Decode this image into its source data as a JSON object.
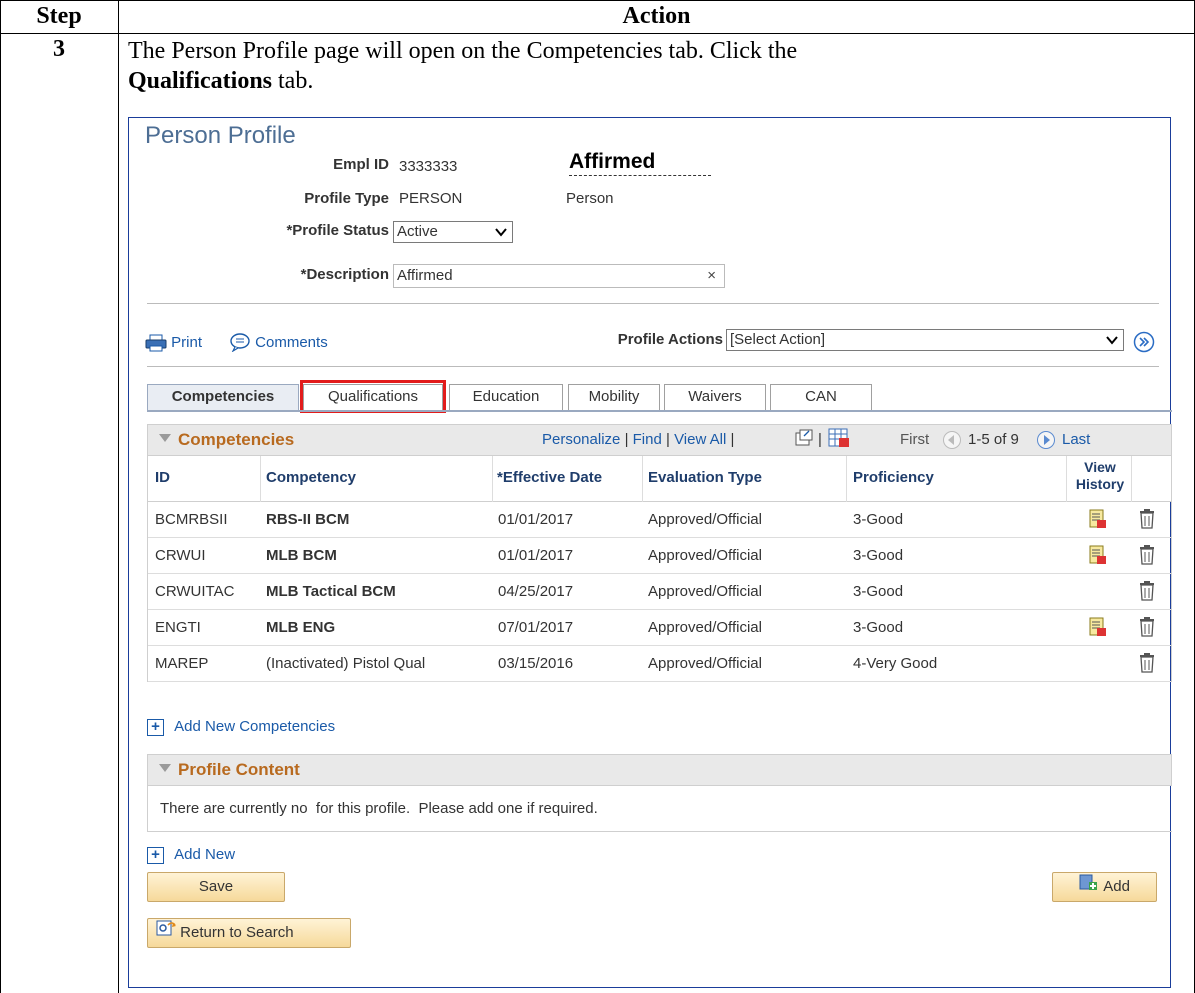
{
  "table": {
    "step_header": "Step",
    "action_header": "Action",
    "step_number": "3",
    "instruction_text": "The Person Profile page will open on the Competencies tab. Click the",
    "instruction_bold": "Qualifications",
    "instruction_suffix": " tab."
  },
  "page": {
    "title": "Person Profile",
    "empl_id_label": "Empl ID",
    "empl_id": "3333333",
    "affirmed": "Affirmed",
    "profile_type_label": "Profile Type",
    "profile_type": "PERSON",
    "profile_type_desc": "Person",
    "profile_status_label": "*Profile Status",
    "profile_status": "Active",
    "description_label": "*Description",
    "description": "Affirmed",
    "clear_glyph": "×"
  },
  "toolbar": {
    "print": "Print",
    "comments": "Comments",
    "profile_actions_label": "Profile Actions",
    "profile_actions_value": "[Select Action]"
  },
  "tabs": [
    {
      "label": "Competencies"
    },
    {
      "label": "Qualifications"
    },
    {
      "label": "Education"
    },
    {
      "label": "Mobility"
    },
    {
      "label": "Waivers"
    },
    {
      "label": "CAN"
    }
  ],
  "grid": {
    "title": "Competencies",
    "personalize": "Personalize",
    "find": "Find",
    "view_all": "View All",
    "sep": "|",
    "first": "First",
    "range": "1-5 of 9",
    "last": "Last",
    "columns": [
      "ID",
      "Competency",
      "*Effective Date",
      "Evaluation Type",
      "Proficiency",
      "View History"
    ],
    "rows": [
      {
        "id": "BCMRBSII",
        "competency": "RBS-II BCM",
        "date": "01/01/2017",
        "eval": "Approved/Official",
        "prof": "3-Good",
        "history": true
      },
      {
        "id": "CRWUI",
        "competency": "MLB BCM",
        "date": "01/01/2017",
        "eval": "Approved/Official",
        "prof": "3-Good",
        "history": true
      },
      {
        "id": "CRWUITAC",
        "competency": "MLB Tactical BCM",
        "date": "04/25/2017",
        "eval": "Approved/Official",
        "prof": "3-Good",
        "history": false
      },
      {
        "id": "ENGTI",
        "competency": "MLB ENG",
        "date": "07/01/2017",
        "eval": "Approved/Official",
        "prof": "3-Good",
        "history": true
      },
      {
        "id": "MAREP",
        "competency": "(Inactivated) Pistol Qual",
        "date": "03/15/2016",
        "eval": "Approved/Official",
        "prof": "4-Very Good",
        "history": false
      }
    ],
    "add_new": "Add New Competencies"
  },
  "profile_content": {
    "title": "Profile Content",
    "message": "There are currently no  for this profile.  Please add one if required.",
    "add_new": "Add New"
  },
  "buttons": {
    "save": "Save",
    "add": "Add",
    "return": "Return to Search"
  }
}
